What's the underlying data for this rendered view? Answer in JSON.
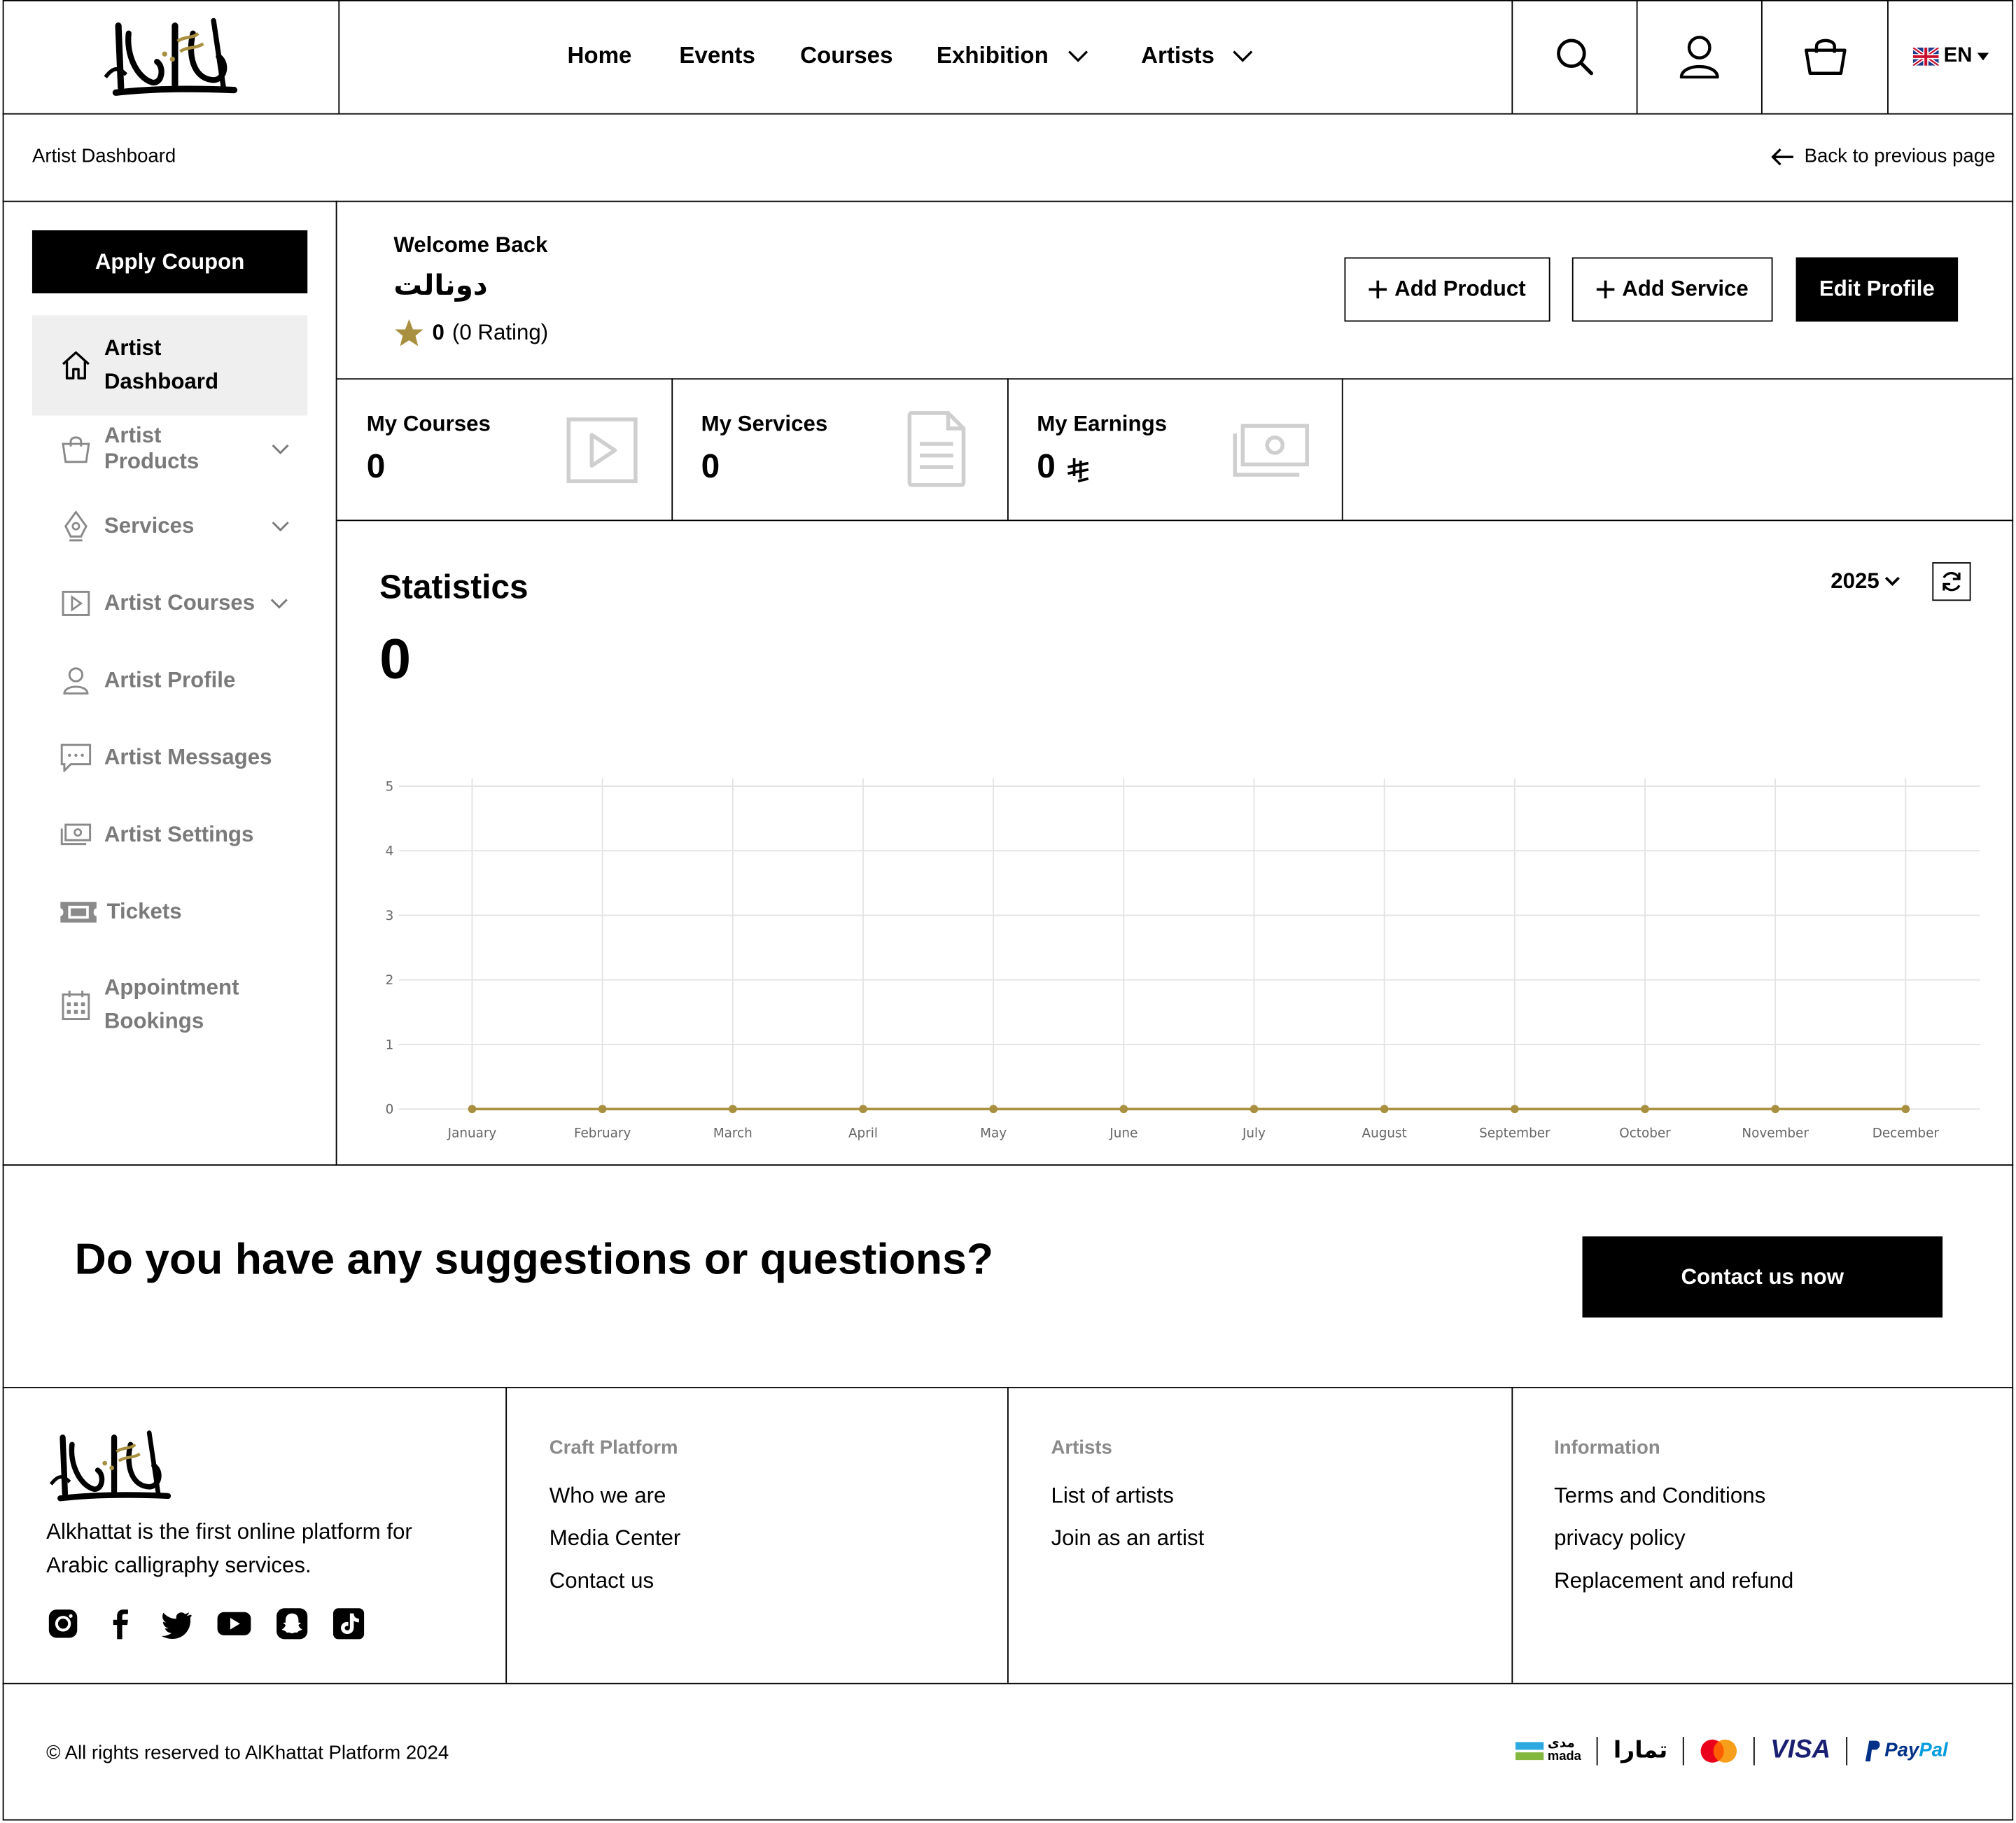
{
  "header": {
    "nav": [
      {
        "label": "Home",
        "dropdown": false
      },
      {
        "label": "Events",
        "dropdown": false
      },
      {
        "label": "Courses",
        "dropdown": false
      },
      {
        "label": "Exhibition",
        "dropdown": true
      },
      {
        "label": "Artists",
        "dropdown": true
      }
    ],
    "language": "EN",
    "icons": [
      "search-icon",
      "user-icon",
      "cart-icon",
      "uk-flag-icon"
    ]
  },
  "subheader": {
    "breadcrumb": "Artist Dashboard",
    "back_label": "Back to previous page"
  },
  "sidebar": {
    "coupon_button": "Apply Coupon",
    "items": [
      {
        "label_line1": "Artist",
        "label_line2": "Dashboard",
        "icon": "home-icon",
        "active": true
      },
      {
        "label": "Artist Products",
        "icon": "bag-icon",
        "chevron": true
      },
      {
        "label": "Services",
        "icon": "pen-nib-icon",
        "chevron": true
      },
      {
        "label": "Artist Courses",
        "icon": "play-icon",
        "chevron": true
      },
      {
        "label": "Artist Profile",
        "icon": "user-icon"
      },
      {
        "label": "Artist Messages",
        "icon": "message-icon"
      },
      {
        "label": "Artist Settings",
        "icon": "money-icon"
      },
      {
        "label": "Tickets",
        "icon": "ticket-icon"
      },
      {
        "label_line1": "Appointment",
        "label_line2": "Bookings",
        "icon": "calendar-icon"
      }
    ]
  },
  "profile": {
    "welcome": "Welcome Back",
    "name": "دونالت",
    "rating_value": "0",
    "rating_count": "(0 Rating)"
  },
  "actions": {
    "add_product": "Add Product",
    "add_service": "Add Service",
    "edit_profile": "Edit Profile"
  },
  "cards": [
    {
      "label": "My Courses",
      "value": "0",
      "icon": "play-icon"
    },
    {
      "label": "My Services",
      "value": "0",
      "icon": "document-icon"
    },
    {
      "label": "My Earnings",
      "value": "0",
      "currency": "riyal-symbol",
      "icon": "money-icon"
    }
  ],
  "statistics": {
    "title": "Statistics",
    "total": "0",
    "year": "2025"
  },
  "chart_data": {
    "type": "line",
    "categories": [
      "January",
      "February",
      "March",
      "April",
      "May",
      "June",
      "July",
      "August",
      "September",
      "October",
      "November",
      "December"
    ],
    "series": [
      {
        "values": [
          0,
          0,
          0,
          0,
          0,
          0,
          0,
          0,
          0,
          0,
          0,
          0
        ],
        "color": "#a89040"
      }
    ],
    "ylim": [
      0,
      5
    ],
    "yticks": [
      "0",
      "1",
      "2",
      "3",
      "4",
      "5"
    ],
    "grid": true,
    "title": "",
    "xlabel": "",
    "ylabel": ""
  },
  "cta": {
    "question": "Do you have any suggestions or questions?",
    "button": "Contact us now"
  },
  "footer": {
    "about": "Alkhattat is the first online platform for Arabic calligraphy services.",
    "social": [
      "instagram-icon",
      "facebook-icon",
      "twitter-icon",
      "youtube-icon",
      "snapchat-icon",
      "tiktok-icon"
    ],
    "columns": [
      {
        "title": "Craft Platform",
        "links": [
          "Who we are",
          "Media Center",
          "Contact us"
        ]
      },
      {
        "title": "Artists",
        "links": [
          "List of artists",
          "Join as an artist"
        ]
      },
      {
        "title": "Information",
        "links": [
          "Terms and Conditions",
          "privacy policy",
          "Replacement and refund"
        ]
      }
    ],
    "copyright": "© All rights reserved to AlKhattat Platform 2024",
    "payments": {
      "mada_ar": "مدى",
      "mada": "mada",
      "tamara": "تمارا",
      "visa": "VISA",
      "paypal_p": "Pay",
      "paypal_pal": "Pal"
    }
  },
  "colors": {
    "accent": "#a89040",
    "grid": "#e3e3e3",
    "muted": "#7a7a7a"
  }
}
